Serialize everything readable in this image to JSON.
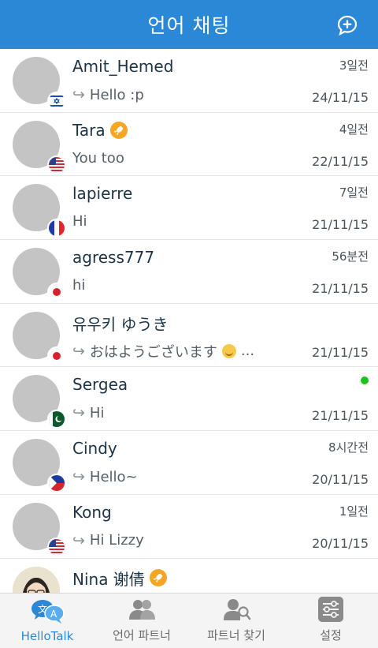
{
  "header": {
    "title": "언어 채팅",
    "new_chat_icon": "add-chat-icon"
  },
  "chats": [
    {
      "name": "Amit_Hemed",
      "preview": "Hello :p",
      "reply": true,
      "rel": "3일전",
      "date": "24/11/15",
      "flag": "Israel"
    },
    {
      "name": "Tara",
      "badge": "rocket",
      "preview": "You too",
      "reply": false,
      "rel": "4일전",
      "date": "22/11/15",
      "flag": "United States"
    },
    {
      "name": "lapierre",
      "preview": "Hi",
      "reply": false,
      "rel": "7일전",
      "date": "21/11/15",
      "flag": "France"
    },
    {
      "name": "agress777",
      "preview": "hi",
      "reply": false,
      "rel": "56분전",
      "date": "21/11/15",
      "flag": "Japan"
    },
    {
      "name": "유우키 ゆうき",
      "preview": "おはようございます",
      "preview_suffix": "...",
      "reply": true,
      "rel": "",
      "date": "21/11/15",
      "flag": "Japan"
    },
    {
      "name": "Sergea",
      "preview": "Hi",
      "reply": true,
      "rel": "",
      "online": true,
      "date": "21/11/15",
      "flag": "Pakistan"
    },
    {
      "name": "Cindy",
      "preview": "Hello~",
      "reply": true,
      "rel": "8시간전",
      "date": "20/11/15",
      "flag": "Philippines"
    },
    {
      "name": "Kong",
      "preview": "Hi Lizzy",
      "reply": true,
      "rel": "1일전",
      "date": "20/11/15",
      "flag": "United States"
    },
    {
      "name": "Nina 谢倩",
      "badge": "rocket",
      "preview": "",
      "reply": false,
      "rel": "",
      "date": "",
      "flag": ""
    }
  ],
  "tabs": [
    {
      "label": "HelloTalk",
      "icon": "hellotalk-translate-icon",
      "active": true
    },
    {
      "label": "언어 파트너",
      "icon": "partners-icon",
      "active": false
    },
    {
      "label": "파트너 찾기",
      "icon": "find-partner-icon",
      "active": false
    },
    {
      "label": "설정",
      "icon": "settings-icon",
      "active": false
    }
  ],
  "colors": {
    "header": "#2a88d6",
    "online": "#1bc41b",
    "badge": "#f5a623",
    "active_tab": "#2a88d6"
  }
}
